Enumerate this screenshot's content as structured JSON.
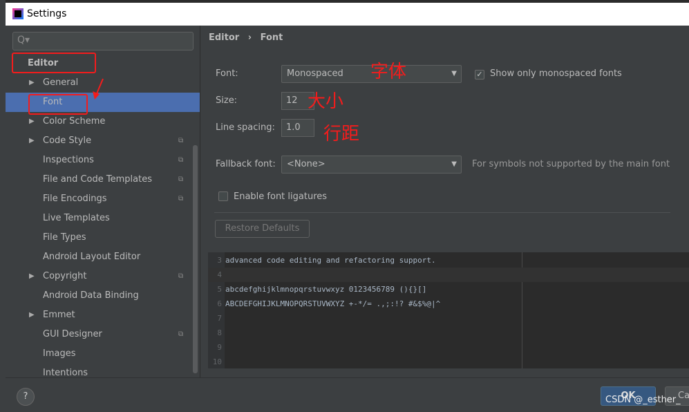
{
  "window": {
    "title": "Settings"
  },
  "sidebar": {
    "search_placeholder": "Q▾",
    "items": [
      {
        "label": "Editor",
        "bold": true
      },
      {
        "label": "General",
        "arrow": true
      },
      {
        "label": "Font",
        "selected": true
      },
      {
        "label": "Color Scheme",
        "arrow": true
      },
      {
        "label": "Code Style",
        "arrow": true,
        "copy": true
      },
      {
        "label": "Inspections",
        "copy": true
      },
      {
        "label": "File and Code Templates",
        "copy": true
      },
      {
        "label": "File Encodings",
        "copy": true
      },
      {
        "label": "Live Templates"
      },
      {
        "label": "File Types"
      },
      {
        "label": "Android Layout Editor"
      },
      {
        "label": "Copyright",
        "arrow": true,
        "copy": true
      },
      {
        "label": "Android Data Binding"
      },
      {
        "label": "Emmet",
        "arrow": true
      },
      {
        "label": "GUI Designer",
        "copy": true
      },
      {
        "label": "Images"
      },
      {
        "label": "Intentions"
      }
    ]
  },
  "breadcrumb": {
    "parent": "Editor",
    "sep": "›",
    "current": "Font"
  },
  "form": {
    "font_label": "Font:",
    "font_value": "Monospaced",
    "show_mono_label": "Show only monospaced fonts",
    "show_mono_checked": true,
    "size_label": "Size:",
    "size_value": "12",
    "spacing_label": "Line spacing:",
    "spacing_value": "1.0",
    "fallback_label": "Fallback font:",
    "fallback_value": "<None>",
    "fallback_hint": "For symbols not supported by the main font",
    "ligatures_label": "Enable font ligatures",
    "ligatures_checked": false,
    "restore_label": "Restore Defaults"
  },
  "preview": {
    "lines": [
      {
        "n": "3",
        "text": "advanced code editing and refactoring support."
      },
      {
        "n": "4",
        "text": ""
      },
      {
        "n": "5",
        "text": "abcdefghijklmnopqrstuvwxyz 0123456789 (){}[]"
      },
      {
        "n": "6",
        "text": "ABCDEFGHIJKLMNOPQRSTUVWXYZ +-*/= .,;:!? #&$%@|^"
      },
      {
        "n": "7",
        "text": ""
      },
      {
        "n": "8",
        "text": ""
      },
      {
        "n": "9",
        "text": ""
      },
      {
        "n": "10",
        "text": ""
      }
    ]
  },
  "footer": {
    "help": "?",
    "ok": "OK",
    "cancel": "Ca",
    "watermark": "CSDN @_esther_"
  },
  "annotations": {
    "font": "字体",
    "size": "大小",
    "spacing": "行距"
  },
  "colors": {
    "selection": "#4b6eaf",
    "annotation": "#f41c1c",
    "panel": "#3c3f41"
  }
}
